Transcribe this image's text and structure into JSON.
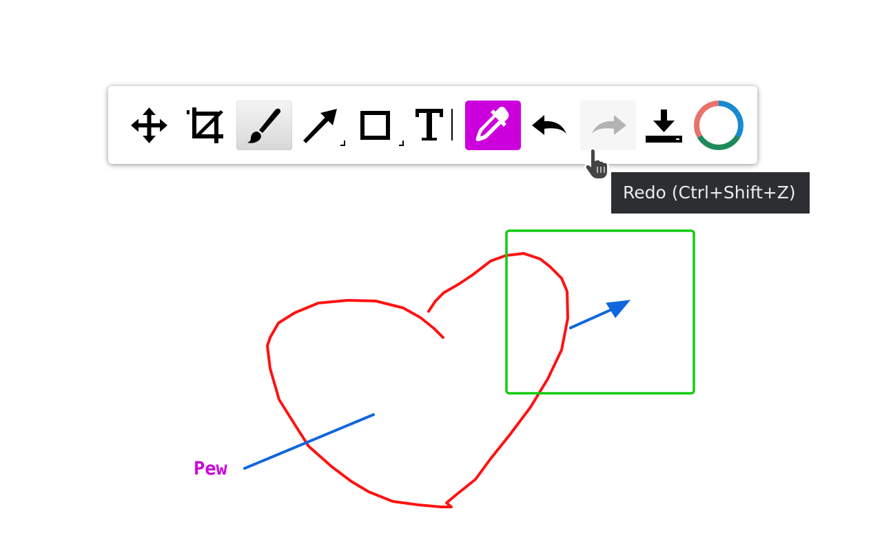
{
  "toolbar": {
    "tools": [
      {
        "name": "move",
        "icon": "move-icon",
        "active": false
      },
      {
        "name": "crop",
        "icon": "crop-icon",
        "active": false
      },
      {
        "name": "brush",
        "icon": "brush-icon",
        "active": true
      },
      {
        "name": "arrow",
        "icon": "arrow-icon",
        "active": false,
        "has_submenu": true
      },
      {
        "name": "rectangle",
        "icon": "rectangle-icon",
        "active": false,
        "has_submenu": true
      },
      {
        "name": "text",
        "icon": "text-icon",
        "active": false
      },
      {
        "name": "color-picker",
        "icon": "eyedropper-icon",
        "color": "#cc00dd"
      },
      {
        "name": "undo",
        "icon": "undo-icon",
        "enabled": true
      },
      {
        "name": "redo",
        "icon": "redo-icon",
        "enabled": false,
        "hovered": true
      },
      {
        "name": "save",
        "icon": "download-icon"
      },
      {
        "name": "color-wheel",
        "icon": "color-wheel-icon"
      }
    ]
  },
  "tooltip": {
    "text": "Redo (Ctrl+Shift+Z)"
  },
  "canvas": {
    "annotations": [
      {
        "type": "text",
        "text": "Pew",
        "color": "#cc00dd"
      }
    ],
    "colors": {
      "heart_stroke": "#ff1111",
      "rectangle_stroke": "#11cc11",
      "arrows": "#1166dd",
      "text": "#cc00dd"
    }
  },
  "colors": {
    "accent": "#cc00dd",
    "tooltip_bg": "#2c2e31",
    "tooltip_text": "#ececec",
    "wheel_blue": "#1a8ad0",
    "wheel_green": "#1f8a5c",
    "wheel_red": "#e8736a"
  }
}
